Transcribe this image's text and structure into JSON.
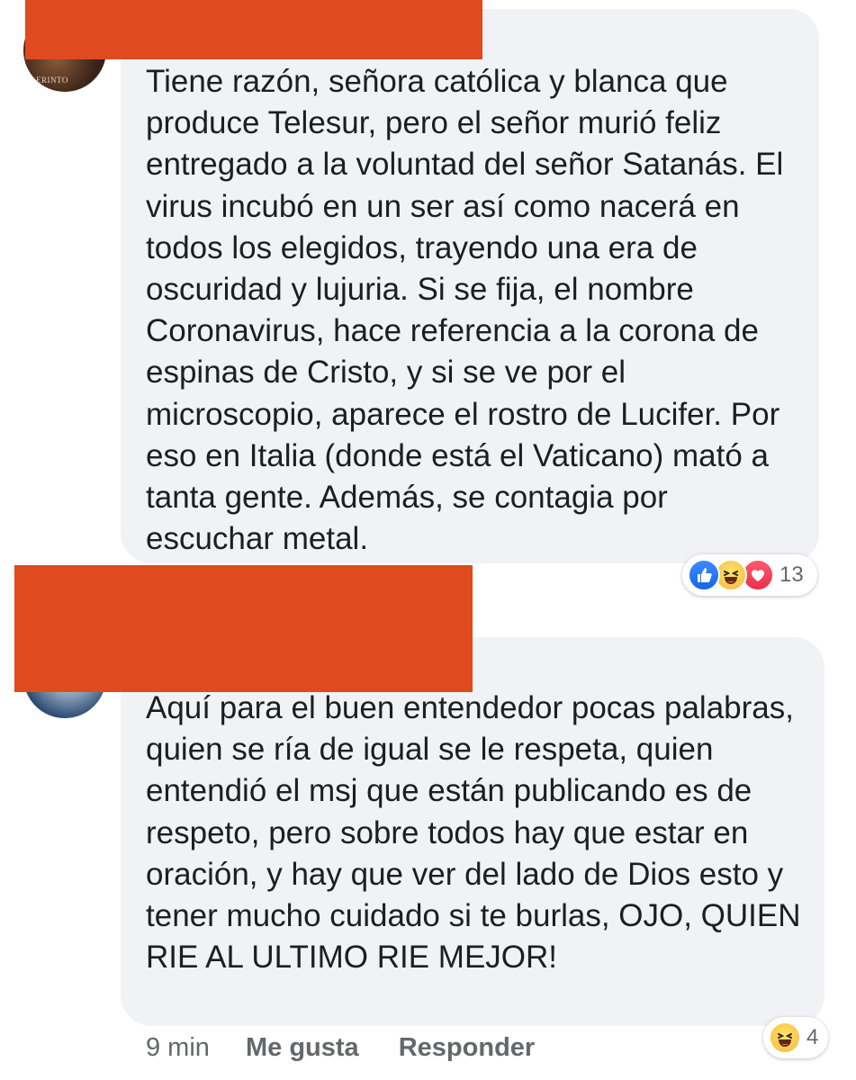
{
  "comments": [
    {
      "text": "Tiene razón, señora católica y blanca que produce Telesur, pero el señor murió feliz entregado a la voluntad del señor Satanás. El virus incubó en un ser así como nacerá en todos los elegidos, trayendo una era de oscuridad y lujuria. Si se fija, el nombre Coronavirus, hace referencia a la corona de espinas de Cristo, y si se ve por el microscopio, aparece el rostro de Lucifer. Por eso en Italia (donde está el Vaticano) mató a tanta gente. Además, se contagia por escuchar metal.",
      "avatar_text": "ERINTO",
      "actions_visible_fragment": "onder",
      "reactions": [
        "like-icon",
        "haha-icon",
        "love-icon"
      ],
      "reaction_count": "13"
    },
    {
      "text": "Aquí para el buen entendedor pocas palabras, quien se ría de igual se le respeta, quien entendió el msj que están publicando es de respeto, pero sobre todos hay que estar en oración, y hay que ver del lado de Dios esto y tener mucho cuidado si te burlas, OJO, QUIEN RIE AL ULTIMO RIE MEJOR!",
      "time": "9 min",
      "like_label": "Me gusta",
      "reply_label": "Responder",
      "reactions": [
        "haha-icon"
      ],
      "reaction_count": "4"
    }
  ],
  "colors": {
    "bubble": "#f0f2f5",
    "redaction": "#df4a1f",
    "action_text": "#65676b",
    "like": "#1666e8",
    "haha": "#f6b73c",
    "love": "#e8304a"
  }
}
